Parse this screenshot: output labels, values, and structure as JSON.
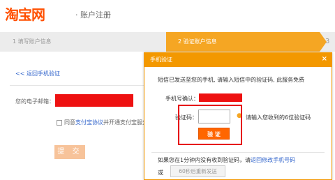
{
  "header": {
    "logo": "淘宝网",
    "subtitle": "· 账户注册"
  },
  "steps": {
    "step1": "1 填写账户信息",
    "step2": "2 验证账户信息",
    "step3": "3"
  },
  "form": {
    "back_link": "<< 返回手机验证",
    "email_label": "您的电子邮箱：",
    "agree_prefix": "同意",
    "agree_link": "支付宝协议",
    "agree_suffix": "并开通支付宝服务",
    "submit": "提 交"
  },
  "modal": {
    "title": "手机验证",
    "close": "×",
    "info": "短信已发送至您的手机, 请输入短信中的验证码, 此服务免费",
    "phone_label": "手机号确认：",
    "code_label": "验证码：",
    "code_value": "",
    "hint": "请输入您收到的6位验证码",
    "verify_btn": "验 证",
    "resend_prefix": "如果您在1分钟内没有收到验证码，请",
    "resend_link": "返回修改手机号码",
    "or": "或",
    "resend_btn": "60秒后重新发送"
  },
  "colors": {
    "brand": "#ff5000",
    "accent": "#f39800",
    "link": "#3366cc",
    "redacted": "#ee1111"
  }
}
